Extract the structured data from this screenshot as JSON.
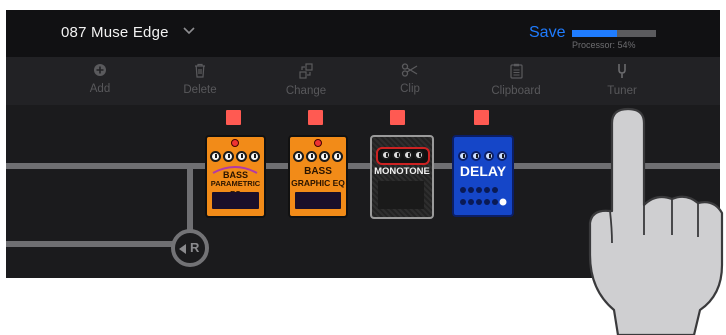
{
  "header": {
    "preset_name": "087 Muse Edge",
    "save_label": "Save",
    "processor_label": "Processor: 54%",
    "processor_load": 0.54
  },
  "toolbar": {
    "items": [
      {
        "label": "Add",
        "icon": "plus-circle-icon"
      },
      {
        "label": "Delete",
        "icon": "trash-icon"
      },
      {
        "label": "Change",
        "icon": "swap-icon"
      },
      {
        "label": "Clip",
        "icon": "scissors-icon"
      },
      {
        "label": "Clipboard",
        "icon": "clipboard-icon"
      },
      {
        "label": "Tuner",
        "icon": "tuning-fork-icon"
      }
    ]
  },
  "pedals": [
    {
      "name_line1": "BASS",
      "name_line2": "PARAMETRIC EQ",
      "color": "#f28b18"
    },
    {
      "name_line1": "BASS",
      "name_line2": "GRAPHIC EQ",
      "color": "#f28b18"
    },
    {
      "name_line1": "MONOTONE",
      "name_line2": "",
      "color": "#2a2a2a"
    },
    {
      "name_line1": "DELAY",
      "name_line2": "",
      "color": "#1546c8"
    }
  ],
  "routing": {
    "label": "R"
  },
  "colors": {
    "accent": "#1f7cff",
    "led": "#ff5a52"
  }
}
